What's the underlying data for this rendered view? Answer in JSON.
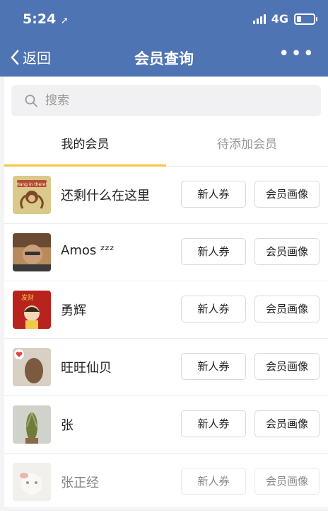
{
  "status": {
    "time": "5:24",
    "network": "4G"
  },
  "nav": {
    "back_label": "返回",
    "title": "会员查询",
    "more_label": "•••"
  },
  "search": {
    "placeholder": "搜索"
  },
  "tabs": [
    {
      "label": "我的会员",
      "active": true
    },
    {
      "label": "待添加会员",
      "active": false
    }
  ],
  "members": [
    {
      "name": "还剩什么在这里",
      "coupon_label": "新人券",
      "profile_label": "会员画像"
    },
    {
      "name": "Amos ᶻᶻᶻ",
      "coupon_label": "新人券",
      "profile_label": "会员画像"
    },
    {
      "name": "勇辉",
      "coupon_label": "新人券",
      "profile_label": "会员画像"
    },
    {
      "name": "旺旺仙贝",
      "coupon_label": "新人券",
      "profile_label": "会员画像"
    },
    {
      "name": "张",
      "coupon_label": "新人券",
      "profile_label": "会员画像"
    },
    {
      "name": "张正经",
      "coupon_label": "新人券",
      "profile_label": "会员画像"
    }
  ],
  "colors": {
    "header": "#4f74b3",
    "tab_indicator": "#f5c542"
  },
  "avatar_texts": {
    "0": "Hang in there!",
    "2": "发财"
  }
}
